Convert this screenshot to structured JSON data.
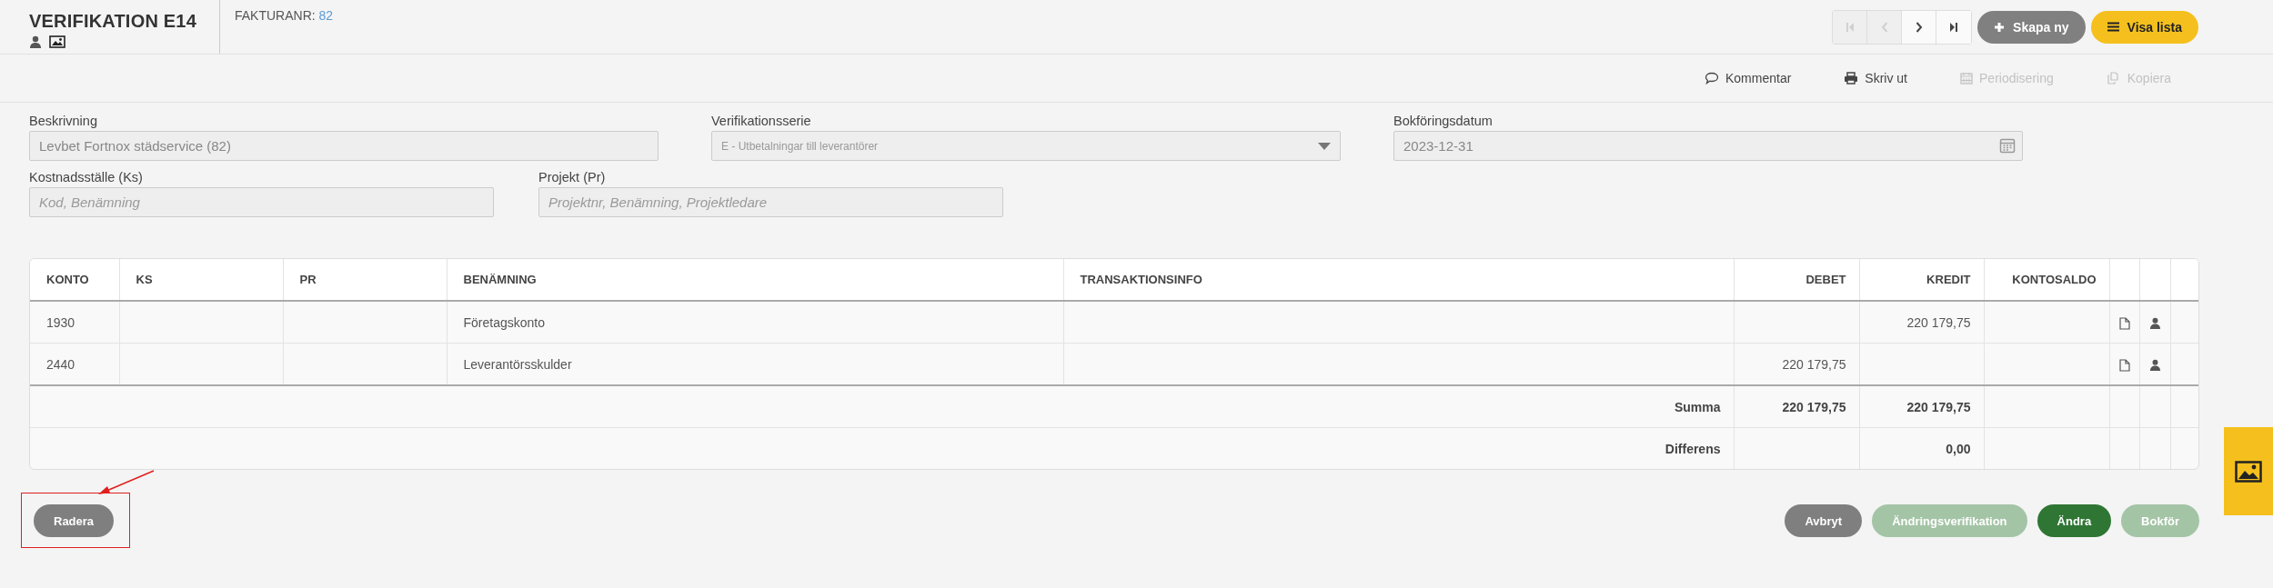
{
  "header": {
    "title": "VERIFIKATION E14",
    "invoice_label": "FAKTURANR:",
    "invoice_number": "82"
  },
  "nav": [
    {
      "kind": "first",
      "disabled": true
    },
    {
      "kind": "prev",
      "disabled": true
    },
    {
      "kind": "next",
      "disabled": false
    },
    {
      "kind": "last",
      "disabled": false
    }
  ],
  "header_buttons": [
    {
      "label": "Skapa ny",
      "kind": "add"
    },
    {
      "label": "Visa lista",
      "kind": "list"
    }
  ],
  "toolbar": [
    {
      "label": "Kommentar",
      "kind": "comment",
      "disabled": false
    },
    {
      "label": "Skriv ut",
      "kind": "print",
      "disabled": false
    },
    {
      "label": "Periodisering",
      "kind": "calendar",
      "disabled": true
    },
    {
      "label": "Kopiera",
      "kind": "copy",
      "disabled": true
    }
  ],
  "form_rows": [
    [
      {
        "label": "Beskrivning",
        "kind": "text",
        "value": "Levbet Fortnox städservice (82)"
      },
      {
        "label": "Verifikationsserie",
        "kind": "select",
        "value": "E - Utbetalningar till leverantörer"
      },
      {
        "label": "Bokföringsdatum",
        "kind": "date",
        "value": "2023-12-31"
      }
    ],
    [
      {
        "label": "Kostnadsställe (Ks)",
        "kind": "text",
        "placeholder": "Kod, Benämning"
      },
      {
        "label": "Projekt (Pr)",
        "kind": "text",
        "placeholder": "Projektnr, Benämning, Projektledare"
      }
    ]
  ],
  "table": {
    "columns": [
      {
        "label": "KONTO",
        "kind": "text"
      },
      {
        "label": "KS",
        "kind": "text"
      },
      {
        "label": "PR",
        "kind": "text"
      },
      {
        "label": "BENÄMNING",
        "kind": "text"
      },
      {
        "label": "TRANSAKTIONSINFO",
        "kind": "text"
      },
      {
        "label": "DEBET",
        "kind": "amount"
      },
      {
        "label": "KREDIT",
        "kind": "amount"
      },
      {
        "label": "KONTOSALDO",
        "kind": "amount"
      },
      {
        "kind": "file"
      },
      {
        "kind": "user"
      },
      {
        "kind": "blank"
      }
    ],
    "rows": [
      {
        "konto": "1930",
        "benamning": "Företagskonto",
        "kredit": "220 179,75"
      },
      {
        "konto": "2440",
        "benamning": "Leverantörsskulder",
        "debet": "220 179,75"
      }
    ],
    "totals": [
      {
        "label": "Summa",
        "debet": "220 179,75",
        "kredit": "220 179,75"
      },
      {
        "label": "Differens",
        "kredit": "0,00"
      }
    ]
  },
  "footer": {
    "left": [
      {
        "label": "Radera",
        "kind": "grey",
        "disabled": false
      }
    ],
    "right": [
      {
        "label": "Avbryt",
        "kind": "grey",
        "disabled": false
      },
      {
        "label": "Ändringsverifikation",
        "kind": "green",
        "disabled": true
      },
      {
        "label": "Ändra",
        "kind": "green",
        "disabled": false
      },
      {
        "label": "Bokför",
        "kind": "green",
        "disabled": true
      }
    ]
  }
}
